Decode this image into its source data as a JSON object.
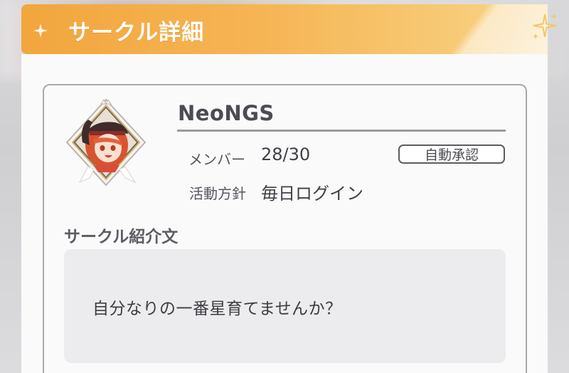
{
  "header": {
    "title": "サークル詳細",
    "accent_color": "#f2a63d"
  },
  "circle": {
    "name": "NeoNGS",
    "member_label": "メンバー",
    "member_value": "28/30",
    "policy_label": "活動方針",
    "policy_value": "毎日ログイン",
    "join_badge": "自動承認"
  },
  "description": {
    "title": "サークル紹介文",
    "text": "自分なりの一番星育てませんか？"
  },
  "icons": {
    "header_left": "sparkle-icon",
    "header_right": "sparkles-icon",
    "avatar": "character-avatar"
  }
}
